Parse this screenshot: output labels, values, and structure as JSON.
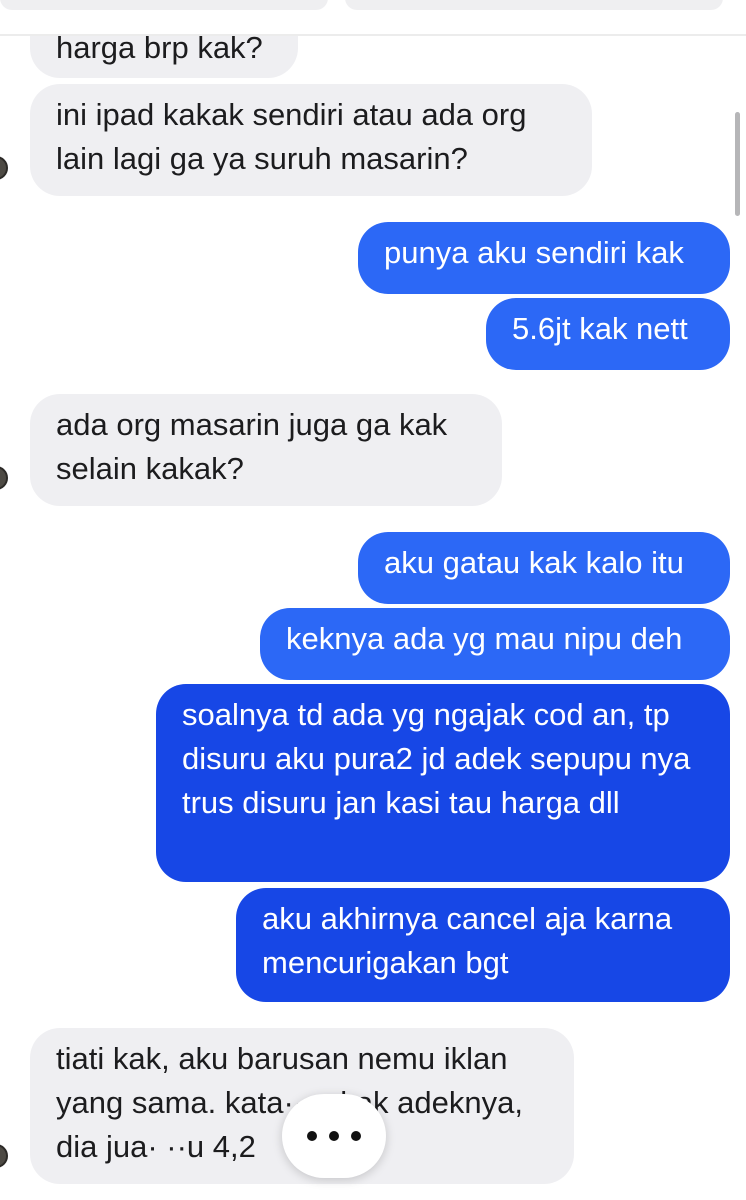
{
  "messages": [
    {
      "id": "m1",
      "side": "in",
      "text": "harga brp kak?"
    },
    {
      "id": "m2",
      "side": "in",
      "text": "ini ipad kakak sendiri atau ada org lain lagi ga ya suruh masarin?"
    },
    {
      "id": "m3",
      "side": "out",
      "text": "punya aku sendiri kak"
    },
    {
      "id": "m4",
      "side": "out",
      "text": "5.6jt kak nett"
    },
    {
      "id": "m5",
      "side": "in",
      "text": "ada org masarin juga ga kak selain kakak?"
    },
    {
      "id": "m6",
      "side": "out",
      "text": "aku gatau kak kalo itu"
    },
    {
      "id": "m7",
      "side": "out",
      "text": "keknya ada yg mau nipu deh"
    },
    {
      "id": "m8",
      "side": "out",
      "text": "soalnya td ada yg ngajak cod an, tp disuru aku pura2 jd adek sepupu nya trus disuru jan kasi tau harga dll"
    },
    {
      "id": "m9",
      "side": "out",
      "text": "aku akhirnya cancel aja karna mencurigakan bgt"
    },
    {
      "id": "m10",
      "side": "in",
      "text": "tiati kak, aku barusan nemu iklan yang sama. kata·· ·akak adeknya, dia jua· ··u 4,2"
    }
  ],
  "colors": {
    "incoming_bg": "#efeff2",
    "outgoing_bg": "#2c68f6",
    "outgoing_bg_deep": "#1747e6"
  },
  "icons": {
    "more_button": "more-dots-icon"
  }
}
